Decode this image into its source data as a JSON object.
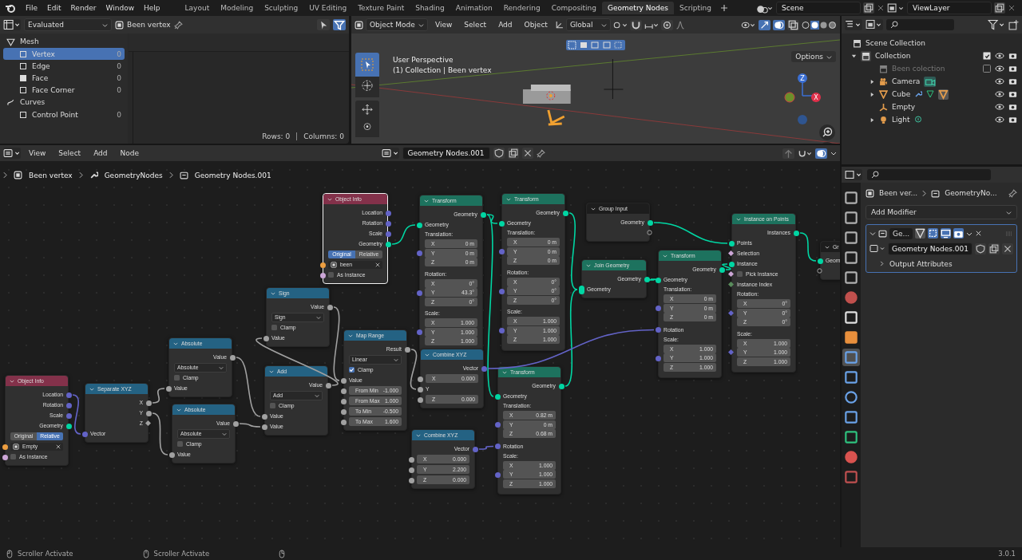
{
  "menu": [
    "File",
    "Edit",
    "Render",
    "Window",
    "Help"
  ],
  "workspaces": [
    {
      "label": "Layout",
      "selected": false
    },
    {
      "label": "Modeling",
      "selected": false
    },
    {
      "label": "Sculpting",
      "selected": false
    },
    {
      "label": "UV Editing",
      "selected": false
    },
    {
      "label": "Texture Paint",
      "selected": false
    },
    {
      "label": "Shading",
      "selected": false
    },
    {
      "label": "Animation",
      "selected": false
    },
    {
      "label": "Rendering",
      "selected": false
    },
    {
      "label": "Compositing",
      "selected": false
    },
    {
      "label": "Geometry Nodes",
      "selected": true
    },
    {
      "label": "Scripting",
      "selected": false
    }
  ],
  "scene": "Scene",
  "view_layer": "ViewLayer",
  "spreadsheet": {
    "evaluation": "Evaluated",
    "object": "Been vertex",
    "groups": [
      {
        "label": "Mesh",
        "kind": "mesh",
        "items": [
          {
            "label": "Vertex",
            "kind": "vertex",
            "count": "0",
            "selected": true
          },
          {
            "label": "Edge",
            "kind": "edge",
            "count": "0",
            "selected": false
          },
          {
            "label": "Face",
            "kind": "face",
            "count": "0",
            "selected": false
          },
          {
            "label": "Face Corner",
            "kind": "corner",
            "count": "0",
            "selected": false
          }
        ]
      },
      {
        "label": "Curves",
        "kind": "curve",
        "items": [
          {
            "label": "Control Point",
            "kind": "point",
            "count": "0",
            "selected": false
          }
        ]
      }
    ],
    "rows": "Rows: 0",
    "columns": "Columns: 0"
  },
  "viewport": {
    "mode": "Object Mode",
    "menus": [
      "View",
      "Select",
      "Add",
      "Object"
    ],
    "orientation": "Global",
    "options": "Options",
    "info": [
      "User Perspective",
      "(1) Collection | Been vertex"
    ],
    "axes": [
      "Z",
      "X"
    ]
  },
  "outliner": {
    "title": "Scene Collection",
    "items": [
      {
        "label": "Collection",
        "kind": "collection",
        "expanded": true,
        "checked": true,
        "children": [
          {
            "label": "Been colection",
            "kind": "collection",
            "checked": false
          },
          {
            "label": "Camera",
            "kind": "camera",
            "expanded": false
          },
          {
            "label": "Cube",
            "kind": "mesh",
            "expanded": false
          },
          {
            "label": "Empty",
            "kind": "empty"
          },
          {
            "label": "Light",
            "kind": "light",
            "expanded": false
          }
        ]
      }
    ]
  },
  "node_editor": {
    "menus": [
      "View",
      "Select",
      "Add",
      "Node"
    ],
    "tree": "Geometry Nodes.001",
    "breadcrumbs": [
      "Been vertex",
      "GeometryNodes",
      "Geometry Nodes.001"
    ],
    "nodes": [
      {
        "title": "Object Info",
        "kind": "input",
        "selected": true,
        "rows": [
          {
            "kind": "output",
            "label": "Location",
            "color": "#6363c7"
          },
          {
            "kind": "output",
            "label": "Rotation",
            "color": "#6363c7"
          },
          {
            "kind": "output",
            "label": "Scale",
            "color": "#6363c7"
          },
          {
            "kind": "output",
            "label": "Geometry",
            "color": "#00d6a3"
          },
          {
            "kind": "toggle",
            "options": [
              {
                "label": "Original",
                "selected": true
              },
              {
                "label": "Relative",
                "selected": false
              }
            ]
          },
          {
            "kind": "object",
            "value": "been",
            "color": "#ed9e40"
          },
          {
            "kind": "checkbox",
            "label": "As Instance",
            "checked": false,
            "color": "#cca6d6"
          }
        ]
      },
      {
        "title": "Transform",
        "kind": "geometry",
        "selected": false,
        "rows": [
          {
            "kind": "output",
            "label": "Geometry",
            "color": "#00d6a3"
          },
          {
            "kind": "input",
            "label": "Geometry",
            "color": "#00d6a3"
          },
          {
            "kind": "vector",
            "label": "Translation:",
            "color": "#6363c7",
            "fields": [
              {
                "axis": "X",
                "value": "0 m"
              },
              {
                "axis": "Y",
                "value": "0 m"
              },
              {
                "axis": "Z",
                "value": "0 m"
              }
            ]
          },
          {
            "kind": "vector",
            "label": "Rotation:",
            "color": "#6363c7",
            "fields": [
              {
                "axis": "X",
                "value": "0°"
              },
              {
                "axis": "Y",
                "value": "43.3°"
              },
              {
                "axis": "Z",
                "value": "0°"
              }
            ]
          },
          {
            "kind": "vector",
            "label": "Scale:",
            "color": "#6363c7",
            "fields": [
              {
                "axis": "X",
                "value": "1.000"
              },
              {
                "axis": "Y",
                "value": "1.000"
              },
              {
                "axis": "Z",
                "value": "1.000"
              }
            ]
          }
        ]
      },
      {
        "title": "Transform",
        "kind": "geometry",
        "selected": false,
        "rows": [
          {
            "kind": "output",
            "label": "Geometry",
            "color": "#00d6a3"
          },
          {
            "kind": "input",
            "label": "Geometry",
            "color": "#00d6a3"
          },
          {
            "kind": "vector",
            "label": "Translation:",
            "color": "#6363c7",
            "fields": [
              {
                "axis": "X",
                "value": "0 m"
              },
              {
                "axis": "Y",
                "value": "0 m"
              },
              {
                "axis": "Z",
                "value": "0 m"
              }
            ]
          },
          {
            "kind": "vector",
            "label": "Rotation:",
            "color": "#6363c7",
            "fields": [
              {
                "axis": "X",
                "value": "0°"
              },
              {
                "axis": "Y",
                "value": "0°"
              },
              {
                "axis": "Z",
                "value": "0°"
              }
            ]
          },
          {
            "kind": "vector",
            "label": "Scale:",
            "color": "#6363c7",
            "fields": [
              {
                "axis": "X",
                "value": "1.000"
              },
              {
                "axis": "Y",
                "value": "1.000"
              },
              {
                "axis": "Z",
                "value": "1.000"
              }
            ]
          }
        ]
      },
      {
        "title": "Group Input",
        "kind": "group",
        "selected": false,
        "rows": [
          {
            "kind": "output",
            "label": "Geometry",
            "color": "#00d6a3"
          },
          {
            "kind": "virtual_output"
          }
        ]
      },
      {
        "title": "Join Geometry",
        "kind": "geometry",
        "selected": false,
        "rows": [
          {
            "kind": "output",
            "label": "Geometry",
            "color": "#00d6a3"
          },
          {
            "kind": "input",
            "label": "Geometry",
            "color": "#00d6a3",
            "multi": true
          }
        ]
      },
      {
        "title": "Transform",
        "kind": "geometry",
        "selected": false,
        "rows": [
          {
            "kind": "output",
            "label": "Geometry",
            "color": "#00d6a3"
          },
          {
            "kind": "input",
            "label": "Geometry",
            "color": "#00d6a3"
          },
          {
            "kind": "vector",
            "label": "Translation:",
            "color": "#6363c7",
            "fields": [
              {
                "axis": "X",
                "value": "0 m"
              },
              {
                "axis": "Y",
                "value": "0 m"
              },
              {
                "axis": "Z",
                "value": "0 m"
              }
            ]
          },
          {
            "kind": "input",
            "label": "Rotation",
            "color": "#6363c7"
          },
          {
            "kind": "vector",
            "label": "Scale:",
            "color": "#6363c7",
            "fields": [
              {
                "axis": "X",
                "value": "1.000"
              },
              {
                "axis": "Y",
                "value": "1.000"
              },
              {
                "axis": "Z",
                "value": "1.000"
              }
            ]
          }
        ]
      },
      {
        "title": "Instance on Points",
        "kind": "geometry",
        "selected": false,
        "rows": [
          {
            "kind": "output",
            "label": "Instances",
            "color": "#00d6a3"
          },
          {
            "kind": "input",
            "label": "Points",
            "color": "#00d6a3"
          },
          {
            "kind": "input",
            "label": "Selection",
            "color": "#cca6d6",
            "field": true
          },
          {
            "kind": "input",
            "label": "Instance",
            "color": "#00d6a3"
          },
          {
            "kind": "checkbox",
            "label": "Pick Instance",
            "checked": false,
            "color": "#cca6d6",
            "field": true
          },
          {
            "kind": "input",
            "label": "Instance Index",
            "color": "#598c5c",
            "field": true
          },
          {
            "kind": "vector",
            "label": "Rotation:",
            "color": "#6363c7",
            "field": true,
            "fields": [
              {
                "axis": "X",
                "value": "0°"
              },
              {
                "axis": "Y",
                "value": "0°"
              },
              {
                "axis": "Z",
                "value": "0°"
              }
            ]
          },
          {
            "kind": "vector",
            "label": "Scale:",
            "color": "#6363c7",
            "field": true,
            "fields": [
              {
                "axis": "X",
                "value": "1.000"
              },
              {
                "axis": "Y",
                "value": "1.000"
              },
              {
                "axis": "Z",
                "value": "1.000"
              }
            ]
          }
        ]
      },
      {
        "title": "Gr",
        "kind": "group",
        "selected": false,
        "rows": [
          {
            "kind": "input",
            "label": "Geom",
            "color": "#00d6a3"
          },
          {
            "kind": "virtual_input"
          }
        ]
      },
      {
        "title": "Sign",
        "kind": "converter",
        "selected": false,
        "rows": [
          {
            "kind": "output",
            "label": "Value",
            "color": "#a1a1a1"
          },
          {
            "kind": "dropdown",
            "value": "Sign"
          },
          {
            "kind": "checkbox",
            "label": "Clamp",
            "checked": false
          },
          {
            "kind": "input",
            "label": "Value",
            "color": "#a1a1a1"
          }
        ]
      },
      {
        "title": "Map Range",
        "kind": "converter",
        "selected": false,
        "rows": [
          {
            "kind": "output",
            "label": "Result",
            "color": "#a1a1a1"
          },
          {
            "kind": "dropdown",
            "value": "Linear"
          },
          {
            "kind": "checkbox",
            "label": "Clamp",
            "checked": true
          },
          {
            "kind": "input",
            "label": "Value",
            "color": "#a1a1a1"
          },
          {
            "kind": "number",
            "label": "From Min",
            "value": "-1.000",
            "color": "#a1a1a1"
          },
          {
            "kind": "number",
            "label": "From Max",
            "value": "1.000",
            "color": "#a1a1a1"
          },
          {
            "kind": "number",
            "label": "To Min",
            "value": "-0.500",
            "color": "#a1a1a1"
          },
          {
            "kind": "number",
            "label": "To Max",
            "value": "1.600",
            "color": "#a1a1a1"
          }
        ]
      },
      {
        "title": "Combine XYZ",
        "kind": "converter",
        "selected": false,
        "rows": [
          {
            "kind": "output",
            "label": "Vector",
            "color": "#6363c7"
          },
          {
            "kind": "number",
            "label": "X",
            "value": "0.000",
            "color": "#a1a1a1"
          },
          {
            "kind": "input",
            "label": "Y",
            "color": "#a1a1a1"
          },
          {
            "kind": "number",
            "label": "Z",
            "value": "0.000",
            "color": "#a1a1a1"
          }
        ]
      },
      {
        "title": "Transform",
        "kind": "geometry",
        "selected": false,
        "rows": [
          {
            "kind": "output",
            "label": "Geometry",
            "color": "#00d6a3"
          },
          {
            "kind": "input",
            "label": "Geometry",
            "color": "#00d6a3"
          },
          {
            "kind": "vector",
            "label": "Translation:",
            "color": "#6363c7",
            "fields": [
              {
                "axis": "X",
                "value": "0.82 m"
              },
              {
                "axis": "Y",
                "value": "0 m"
              },
              {
                "axis": "Z",
                "value": "0.68 m"
              }
            ]
          },
          {
            "kind": "input",
            "label": "Rotation",
            "color": "#6363c7"
          },
          {
            "kind": "vector",
            "label": "Scale:",
            "color": "#6363c7",
            "fields": [
              {
                "axis": "X",
                "value": "1.000"
              },
              {
                "axis": "Y",
                "value": "1.000"
              },
              {
                "axis": "Z",
                "value": "1.000"
              }
            ]
          }
        ]
      },
      {
        "title": "Combine XYZ",
        "kind": "converter",
        "selected": false,
        "rows": [
          {
            "kind": "output",
            "label": "Vector",
            "color": "#6363c7"
          },
          {
            "kind": "number",
            "label": "X",
            "value": "0.000",
            "color": "#a1a1a1"
          },
          {
            "kind": "number",
            "label": "Y",
            "value": "2.200",
            "color": "#a1a1a1"
          },
          {
            "kind": "number",
            "label": "Z",
            "value": "0.000",
            "color": "#a1a1a1"
          }
        ]
      },
      {
        "title": "Add",
        "kind": "converter",
        "selected": false,
        "rows": [
          {
            "kind": "output",
            "label": "Value",
            "color": "#a1a1a1"
          },
          {
            "kind": "dropdown",
            "value": "Add"
          },
          {
            "kind": "checkbox",
            "label": "Clamp",
            "checked": false
          },
          {
            "kind": "input",
            "label": "Value",
            "color": "#a1a1a1"
          },
          {
            "kind": "input",
            "label": "Value",
            "color": "#a1a1a1"
          }
        ]
      },
      {
        "title": "Absolute",
        "kind": "converter",
        "selected": false,
        "rows": [
          {
            "kind": "output",
            "label": "Value",
            "color": "#a1a1a1"
          },
          {
            "kind": "dropdown",
            "value": "Absolute"
          },
          {
            "kind": "checkbox",
            "label": "Clamp",
            "checked": false
          },
          {
            "kind": "input",
            "label": "Value",
            "color": "#a1a1a1"
          }
        ]
      },
      {
        "title": "Absolute",
        "kind": "converter",
        "selected": false,
        "rows": [
          {
            "kind": "output",
            "label": "Value",
            "color": "#a1a1a1"
          },
          {
            "kind": "dropdown",
            "value": "Absolute"
          },
          {
            "kind": "checkbox",
            "label": "Clamp",
            "checked": false
          },
          {
            "kind": "input",
            "label": "Value",
            "color": "#a1a1a1"
          }
        ]
      },
      {
        "title": "Separate XYZ",
        "kind": "converter",
        "selected": false,
        "rows": [
          {
            "kind": "output",
            "label": "X",
            "color": "#a1a1a1"
          },
          {
            "kind": "output",
            "label": "Y",
            "color": "#a1a1a1"
          },
          {
            "kind": "output",
            "label": "Z",
            "color": "#a1a1a1",
            "field": true
          },
          {
            "kind": "input",
            "label": "Vector",
            "color": "#6363c7"
          }
        ]
      },
      {
        "title": "Object Info",
        "kind": "input",
        "selected": false,
        "rows": [
          {
            "kind": "output",
            "label": "Location",
            "color": "#6363c7"
          },
          {
            "kind": "output",
            "label": "Rotation",
            "color": "#6363c7"
          },
          {
            "kind": "output",
            "label": "Scale",
            "color": "#6363c7"
          },
          {
            "kind": "output",
            "label": "Geometry",
            "color": "#00d6a3"
          },
          {
            "kind": "toggle",
            "options": [
              {
                "label": "Original",
                "selected": false
              },
              {
                "label": "Relative",
                "selected": true
              }
            ]
          },
          {
            "kind": "object",
            "value": "Empty",
            "color": "#ed9e40"
          },
          {
            "kind": "checkbox",
            "label": "As Instance",
            "checked": false,
            "color": "#cca6d6"
          }
        ]
      }
    ]
  },
  "properties": {
    "breadcrumbs": [
      "Been ver...",
      "GeometryNo..."
    ],
    "tabs": [
      {
        "kind": "tool",
        "selected": false
      },
      {
        "kind": "render",
        "selected": false
      },
      {
        "kind": "output",
        "selected": false
      },
      {
        "kind": "viewlayer",
        "selected": false
      },
      {
        "kind": "scene",
        "selected": false
      },
      {
        "kind": "world",
        "selected": false
      },
      {
        "kind": "collection",
        "selected": false
      },
      {
        "kind": "object",
        "selected": false
      },
      {
        "kind": "modifier",
        "selected": true
      },
      {
        "kind": "particles",
        "selected": false
      },
      {
        "kind": "physics",
        "selected": false
      },
      {
        "kind": "constraint",
        "selected": false
      },
      {
        "kind": "data",
        "selected": false
      },
      {
        "kind": "material",
        "selected": false
      },
      {
        "kind": "texture",
        "selected": false
      }
    ],
    "add_modifier": "Add Modifier",
    "modifier": {
      "name": "Ge...",
      "expanded": true,
      "tree": "Geometry Nodes.001",
      "section": "Output Attributes",
      "section_expanded": false
    }
  },
  "status_bar": {
    "items": [
      "Scroller Activate",
      "Scroller Activate"
    ],
    "version": "3.0.1"
  }
}
